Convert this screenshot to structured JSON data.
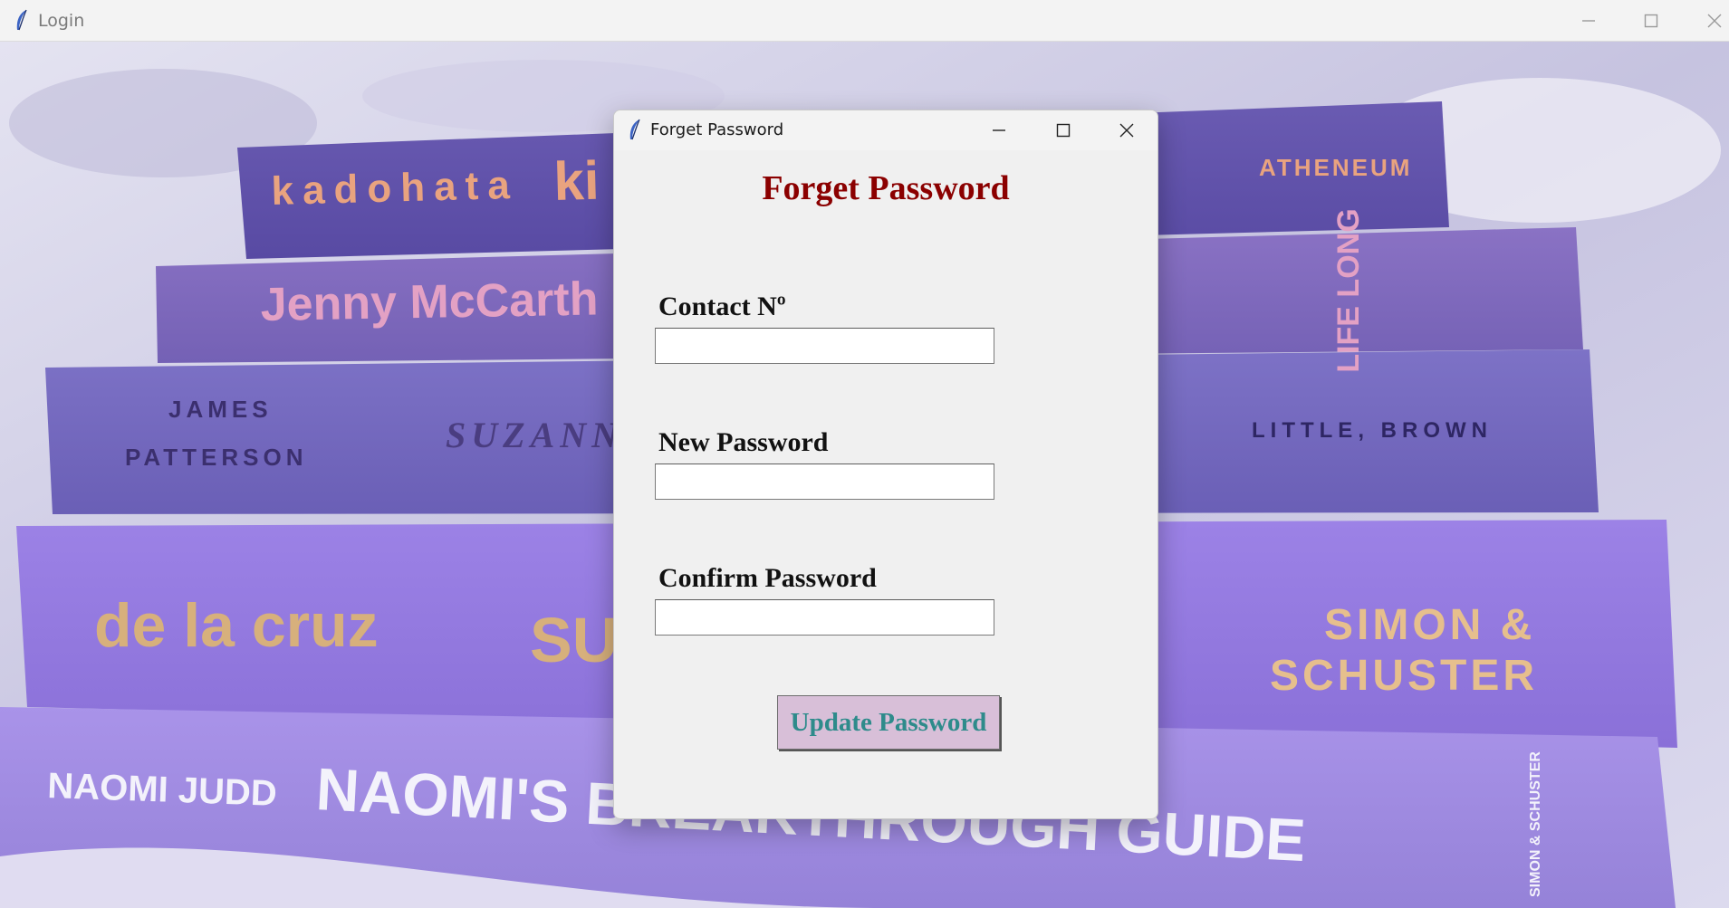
{
  "main_window": {
    "title": "Login",
    "controls": [
      "minimize",
      "maximize",
      "close"
    ]
  },
  "background_books": {
    "left_spines": [
      "kadohata",
      "ki",
      "Jenny McCarth",
      "JAMES",
      "PATTERSON",
      "SUZANNE",
      "de la cruz",
      "SU",
      "NAOMI JUDD",
      "NAOMI'S BREAKTHROUGH GUIDE"
    ],
    "right_spines": [
      "ATHENEUM",
      "LIFE LONG",
      "LITTLE, BROWN",
      "SIMON &",
      "SCHUSTER",
      "SIMON & SCHUSTER"
    ]
  },
  "dialog": {
    "title": "Forget Password",
    "heading": "Forget Password",
    "fields": [
      {
        "label": "Contact  Nº",
        "value": ""
      },
      {
        "label": "New Password",
        "value": ""
      },
      {
        "label": "Confirm Password",
        "value": ""
      }
    ],
    "button": "Update Password"
  },
  "colors": {
    "heading": "#8b0000",
    "button_bg": "#d8bfd8",
    "button_text": "#2e8b8b",
    "dialog_bg": "#f0f0f0"
  }
}
